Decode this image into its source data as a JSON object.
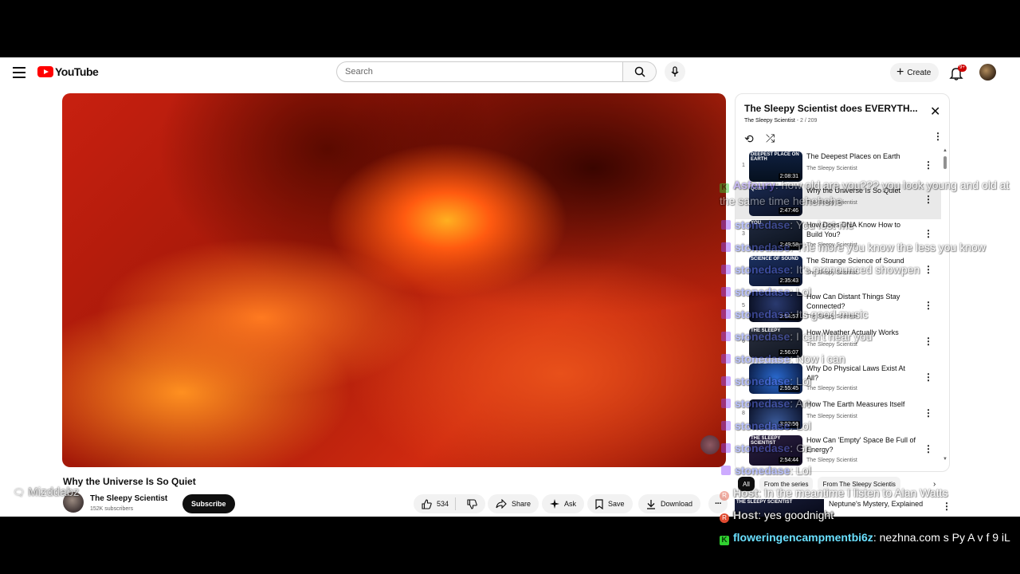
{
  "masthead": {
    "logo_text": "YouTube",
    "search_placeholder": "Search",
    "create_label": "Create",
    "notifications_badge": "9+"
  },
  "video": {
    "title": "Why the Universe Is So Quiet",
    "channel": "The Sleepy Scientist",
    "subscribers": "152K subscribers",
    "subscribe_label": "Subscribe",
    "likes": "534",
    "share_label": "Share",
    "ask_label": "Ask",
    "save_label": "Save",
    "download_label": "Download"
  },
  "playlist": {
    "title": "The Sleepy Scientist does EVERYTH...",
    "owner": "The Sleepy Scientist",
    "position": "2 / 209",
    "items": [
      {
        "index": "1",
        "title": "The Deepest Places on Earth",
        "channel": "The Sleepy Scientist",
        "duration": "2:08:31",
        "thumb_label": "DEEPEST PLACE ON EARTH"
      },
      {
        "index": "",
        "title": "Why the Universe Is So Quiet",
        "channel": "The Sleepy Scientist",
        "duration": "2:47:46",
        "thumb_label": "QUIET"
      },
      {
        "index": "3",
        "title": "How Does DNA Know How to Build You?",
        "channel": "The Sleepy Scientist",
        "duration": "2:49:58",
        "thumb_label": "YOU"
      },
      {
        "index": "",
        "title": "The Strange Science of Sound",
        "channel": "The Sleepy Scientist",
        "duration": "2:35:43",
        "thumb_label": "SCIENCE OF SOUND"
      },
      {
        "index": "5",
        "title": "How Can Distant Things Stay Connected?",
        "channel": "The Sleepy Scientist",
        "duration": "2:54:57",
        "thumb_label": ""
      },
      {
        "index": "6",
        "title": "How Weather Actually Works",
        "channel": "The Sleepy Scientist",
        "duration": "2:56:07",
        "thumb_label": "THE SLEEPY"
      },
      {
        "index": "",
        "title": "Why Do Physical Laws Exist At All?",
        "channel": "The Sleepy Scientist",
        "duration": "2:55:45",
        "thumb_label": ""
      },
      {
        "index": "8",
        "title": "How The Earth Measures Itself",
        "channel": "The Sleepy Scientist",
        "duration": "3:02:56",
        "thumb_label": ""
      },
      {
        "index": "",
        "title": "How Can 'Empty' Space Be Full of Energy?",
        "channel": "The Sleepy Scientist",
        "duration": "2:54:44",
        "thumb_label": "THE SLEEPY SCIENTIST"
      }
    ]
  },
  "chips": [
    "All",
    "From the series",
    "From The Sleepy Scientis"
  ],
  "recommended": {
    "title": "Neptune's Mystery, Explained",
    "thumb_label": "THE SLEEPY SCIENTIST"
  },
  "overlay": {
    "watermark": "Mizddabz",
    "chat": [
      {
        "user": "Asfoury",
        "text": ": how old are you??? you look young and old at the same time hehehehe",
        "badge": "K",
        "faded": true
      },
      {
        "user": "stonedase",
        "text": ": You lost me",
        "badge": "T",
        "faded": true
      },
      {
        "user": "stonedase",
        "text": ": The more you know the less you know",
        "badge": "T",
        "faded": true
      },
      {
        "user": "stonedase",
        "text": ": It's pronounced showpen",
        "badge": "T",
        "faded": true
      },
      {
        "user": "stonedase",
        "text": ": Lol",
        "badge": "T",
        "faded": true
      },
      {
        "user": "stonedase",
        "text": ": Its good music",
        "badge": "T",
        "faded": true
      },
      {
        "user": "stonedase",
        "text": ": I can't hear you",
        "badge": "T",
        "faded": true
      },
      {
        "user": "stonedase",
        "text": ": Now i can",
        "badge": "T",
        "faded": true
      },
      {
        "user": "stonedase",
        "text": ": Lol",
        "badge": "T",
        "faded": true
      },
      {
        "user": "stonedase",
        "text": ": Art",
        "badge": "T",
        "faded": true
      },
      {
        "user": "stonedase",
        "text": ": Lol",
        "badge": "T",
        "faded": true
      },
      {
        "user": "stonedase",
        "text": ": Gn",
        "badge": "T",
        "faded": true
      },
      {
        "user": "stonedase",
        "text": ": Lol",
        "badge": "T",
        "faded": true
      },
      {
        "user": "Host",
        "text": ": In the meantime I listen to Alan Watts",
        "badge": "R",
        "faded": true
      },
      {
        "user": "Host",
        "text": ": yes goodnight",
        "badge": "R",
        "faded": false
      },
      {
        "user": "floweringencampmentbi6z",
        "text": ": nezhna.com s Py A v f 9 iL",
        "badge": "K",
        "faded": false
      }
    ]
  }
}
